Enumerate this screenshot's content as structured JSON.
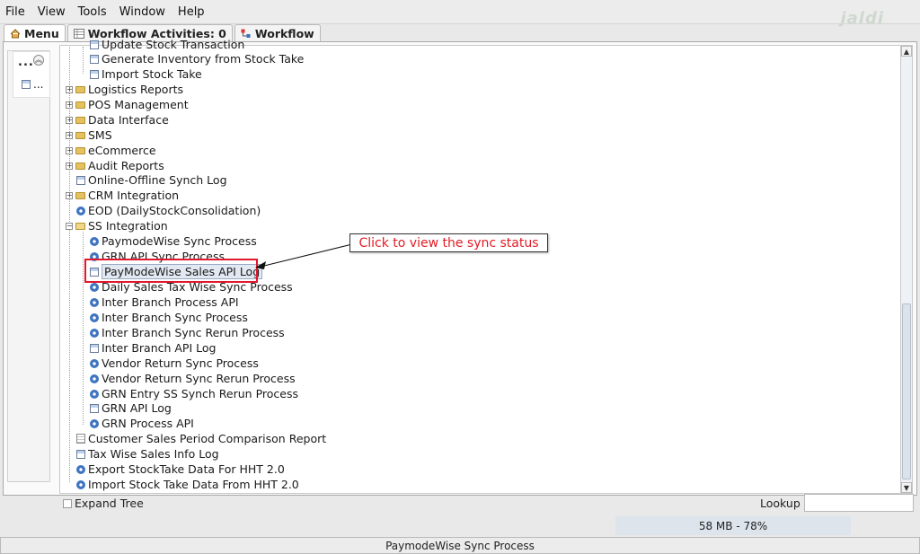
{
  "menubar": {
    "items": [
      {
        "label": "File"
      },
      {
        "label": "View"
      },
      {
        "label": "Tools"
      },
      {
        "label": "Window"
      },
      {
        "label": "Help"
      }
    ],
    "watermark": "jaldi"
  },
  "tabs": [
    {
      "label": "Menu",
      "icon": "home-icon"
    },
    {
      "label": "Workflow Activities: 0",
      "icon": "table-icon"
    },
    {
      "label": "Workflow",
      "icon": "workflow-icon"
    }
  ],
  "side": {
    "dots": "...",
    "collapse_icon": "double-chevron-up-icon",
    "item_label": "..."
  },
  "tree": {
    "rows": [
      {
        "label": "Update Stock Transaction",
        "icon": "doc"
      },
      {
        "label": "Generate Inventory from Stock Take",
        "icon": "doc"
      },
      {
        "label": "Import Stock Take",
        "icon": "doc"
      },
      {
        "label": "Logistics Reports",
        "icon": "folder"
      },
      {
        "label": "POS Management",
        "icon": "folder"
      },
      {
        "label": "Data Interface",
        "icon": "folder"
      },
      {
        "label": "SMS",
        "icon": "folder"
      },
      {
        "label": "eCommerce",
        "icon": "folder"
      },
      {
        "label": "Audit Reports",
        "icon": "folder"
      },
      {
        "label": "Online-Offline Synch Log",
        "icon": "doc"
      },
      {
        "label": "CRM Integration",
        "icon": "folder"
      },
      {
        "label": "EOD (DailyStockConsolidation)",
        "icon": "gear"
      },
      {
        "label": "SS Integration",
        "icon": "folder-open"
      },
      {
        "label": "PaymodeWise Sync Process",
        "icon": "gear"
      },
      {
        "label": "GRN API Sync Process",
        "icon": "gear"
      },
      {
        "label": "PayModeWise Sales API Log",
        "icon": "doc"
      },
      {
        "label": "Daily Sales Tax Wise Sync Process",
        "icon": "gear"
      },
      {
        "label": "Inter Branch Process API",
        "icon": "gear"
      },
      {
        "label": "Inter Branch Sync Process",
        "icon": "gear"
      },
      {
        "label": "Inter Branch Sync Rerun Process",
        "icon": "gear"
      },
      {
        "label": "Inter Branch API Log",
        "icon": "doc"
      },
      {
        "label": "Vendor Return Sync Process",
        "icon": "gear"
      },
      {
        "label": "Vendor Return Sync Rerun Process",
        "icon": "gear"
      },
      {
        "label": "GRN Entry SS Synch Rerun Process",
        "icon": "gear"
      },
      {
        "label": "GRN API Log",
        "icon": "doc"
      },
      {
        "label": "GRN Process API",
        "icon": "gear"
      },
      {
        "label": "Customer Sales Period Comparison Report",
        "icon": "report"
      },
      {
        "label": "Tax Wise Sales Info Log",
        "icon": "doc"
      },
      {
        "label": "Export StockTake Data For HHT 2.0",
        "icon": "gear"
      },
      {
        "label": "Import Stock Take Data From HHT 2.0",
        "icon": "gear"
      }
    ]
  },
  "callout": {
    "text": "Click to view the sync status"
  },
  "bottom": {
    "expand_label": "Expand Tree",
    "lookup_label": "Lookup",
    "lookup_value": ""
  },
  "memory": {
    "text": "58 MB - 78%"
  },
  "status": {
    "text": "PaymodeWise Sync Process"
  }
}
